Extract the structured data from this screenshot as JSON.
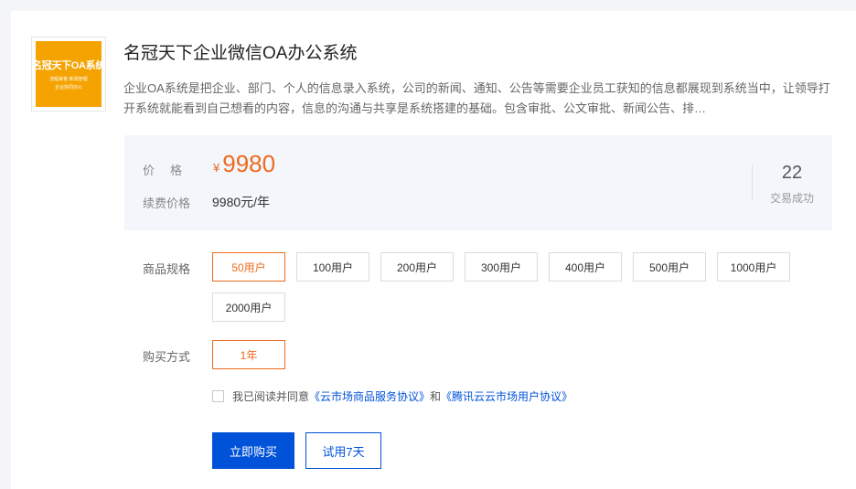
{
  "product": {
    "logo_title": "名冠天下OA系统",
    "logo_sub": "流程审批 新闻管理",
    "logo_sub2": "企业协同办公",
    "title": "名冠天下企业微信OA办公系统",
    "description": "企业OA系统是把企业、部门、个人的信息录入系统，公司的新闻、通知、公告等需要企业员工获知的信息都展现到系统当中，让领导打开系统就能看到自己想看的内容，信息的沟通与共享是系统搭建的基础。包含审批、公文审批、新闻公告、排…"
  },
  "pricing": {
    "price_label": "价格",
    "currency": "¥",
    "price": "9980",
    "renew_label": "续费价格",
    "renew_value": "9980元/年",
    "deals_count": "22",
    "deals_label": "交易成功"
  },
  "spec": {
    "label": "商品规格",
    "selected": "50用户",
    "options": [
      "50用户",
      "100用户",
      "200用户",
      "300用户",
      "400用户",
      "500用户",
      "1000用户",
      "2000用户"
    ]
  },
  "purchase": {
    "label": "购买方式",
    "selected": "1年",
    "options": [
      "1年"
    ]
  },
  "agreement": {
    "checked": false,
    "prefix": "我已阅读并同意",
    "link1": "《云市场商品服务协议》",
    "middle": "和",
    "link2": "《腾讯云云市场用户协议》"
  },
  "actions": {
    "buy_label": "立即购买",
    "trial_label": "试用7天"
  },
  "colors": {
    "accent": "#ee6a1f",
    "primary": "#0052d9",
    "logo_bg": "#f5a300"
  }
}
